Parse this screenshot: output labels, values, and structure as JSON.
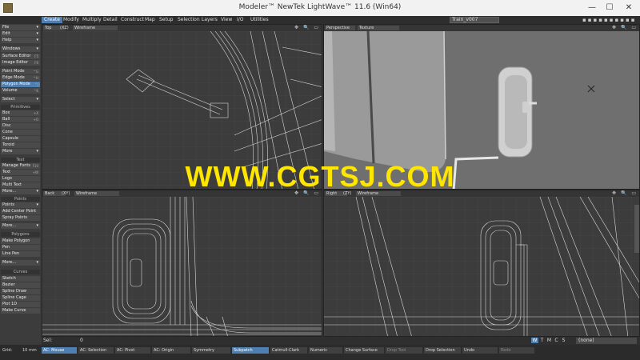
{
  "window": {
    "title": "Modeler™ NewTek LightWave™ 11.6 (Win64)",
    "min": "—",
    "max": "☐",
    "close": "✕"
  },
  "tabs": [
    "Create",
    "Modify",
    "Multiply",
    "Detail",
    "Construct",
    "Map",
    "Setup",
    "Selection",
    "Layers",
    "View",
    "I/O",
    "Utilities"
  ],
  "object_select": "Train_v007",
  "sidebar": {
    "file": "File",
    "edit": "Edit",
    "help": "Help",
    "windows": "Windows",
    "surface_editor": "Surface Editor",
    "surface_editor_key": "F5",
    "image_editor": "Image Editor",
    "image_editor_key": "F6",
    "point_mode": "Point Mode",
    "point_mode_key": "^G",
    "edge_mode": "Edge Mode",
    "edge_mode_key": "^H",
    "polygon_mode": "Polygon Mode",
    "polygon_mode_key": "^J",
    "volume": "Volume",
    "volume_key": "^K",
    "select": "Select",
    "primitives_head": "Primitives",
    "box": "Box",
    "box_key": "+X",
    "ball": "Ball",
    "ball_key": "+O",
    "disc": "Disc",
    "cone": "Cone",
    "capsule": "Capsule",
    "toroid": "Toroid",
    "more1": "More",
    "text_head": "Text",
    "manage_fonts": "Manage Fonts",
    "manage_fonts_key": "F10",
    "text": "Text",
    "text_key": "+W",
    "logo": "Logo",
    "multi_text": "Multi Text",
    "more2": "More...",
    "points_head": "Points",
    "points": "Points",
    "add_center_point": "Add Center Point",
    "spray_points": "Spray Points",
    "more3": "More...",
    "polygons_head": "Polygons",
    "make_polygon": "Make Polygon",
    "pen": "Pen",
    "line_pen": "Line Pen",
    "more4": "More...",
    "curves_head": "Curves",
    "sketch": "Sketch",
    "bezier": "Bezier",
    "spline_draw": "Spline Draw",
    "spline_cage": "Spline Cage",
    "plot_1d": "Plot 1D",
    "make_curve": "Make Curve"
  },
  "viewports": {
    "top": {
      "name": "Top",
      "axis": "(XZ)",
      "mode": "Wireframe"
    },
    "perspective": {
      "name": "Perspective",
      "mode": "Texture"
    },
    "back": {
      "name": "Back",
      "axis": "(XY)",
      "mode": "Wireframe"
    },
    "right": {
      "name": "Right",
      "axis": "(ZY)",
      "mode": "Wireframe"
    },
    "icons": "✥ 🔍 ▭"
  },
  "watermark": "WWW.CGTSJ.COM",
  "selbar": {
    "sel": "Sel:",
    "value": "0",
    "w": "W",
    "t": "T",
    "m": "M",
    "c": "C",
    "s": "S",
    "none": "(none)"
  },
  "statusbar": {
    "grid": "Grid:",
    "grid_val": "10 mm",
    "ac_mouse": "AC: Mouse",
    "ac_selection": "AC: Selection",
    "ac_pivot": "AC: Pivot",
    "ac_origin": "AC: Origin",
    "symmetry": "Symmetry",
    "subpatch": "Subpatch",
    "catmull_clark": "Catmull-Clark",
    "numeric": "Numeric",
    "change_surface": "Change Surface",
    "drop_tool": "Drop Tool",
    "drop_selection": "Drop Selection",
    "undo": "Undo",
    "redo": "Redo"
  }
}
